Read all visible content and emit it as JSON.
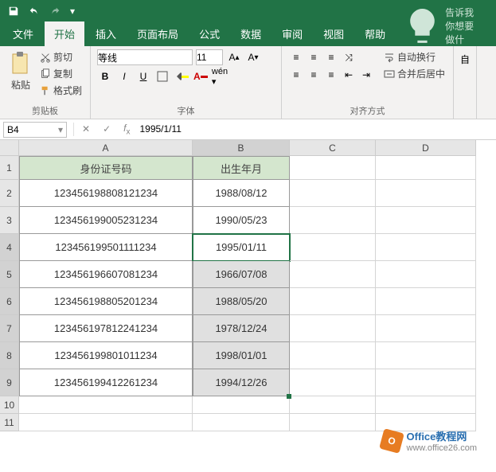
{
  "qat": {
    "save": "save",
    "undo": "undo",
    "redo": "redo"
  },
  "tabs": {
    "file": "文件",
    "home": "开始",
    "insert": "插入",
    "layout": "页面布局",
    "formulas": "公式",
    "data": "数据",
    "review": "审阅",
    "view": "视图",
    "help": "帮助",
    "tell_me": "告诉我你想要做什"
  },
  "ribbon": {
    "clipboard": {
      "paste": "粘贴",
      "cut": "剪切",
      "copy": "复制",
      "format_painter": "格式刷",
      "label": "剪贴板"
    },
    "font": {
      "name": "等线",
      "size": "11",
      "label": "字体",
      "bold": "B",
      "italic": "I",
      "underline": "U"
    },
    "alignment": {
      "wrap": "自动换行",
      "merge": "合并后居中",
      "label": "对齐方式"
    },
    "auto": "自"
  },
  "namebox": "B4",
  "formula": "1995/1/11",
  "columns": [
    "A",
    "B",
    "C",
    "D"
  ],
  "col_widths": {
    "A": 218,
    "B": 122,
    "C": 108,
    "D": 126
  },
  "rows": [
    "1",
    "2",
    "3",
    "4",
    "5",
    "6",
    "7",
    "8",
    "9",
    "10",
    "11"
  ],
  "headers": {
    "id": "身份证号码",
    "dob": "出生年月"
  },
  "data": [
    {
      "id": "123456198808121234",
      "dob": "1988/08/12"
    },
    {
      "id": "123456199005231234",
      "dob": "1990/05/23"
    },
    {
      "id": "123456199501111234",
      "dob": "1995/01/11"
    },
    {
      "id": "123456196607081234",
      "dob": "1966/07/08"
    },
    {
      "id": "123456198805201234",
      "dob": "1988/05/20"
    },
    {
      "id": "123456197812241234",
      "dob": "1978/12/24"
    },
    {
      "id": "123456199801011234",
      "dob": "1998/01/01"
    },
    {
      "id": "123456199412261234",
      "dob": "1994/12/26"
    }
  ],
  "selection": {
    "active": "B4",
    "range": "B4:B9"
  },
  "watermark": {
    "brand": "Office教程网",
    "url": "www.office26.com"
  },
  "chart_data": {
    "type": "table",
    "title": "身份证与出生年月",
    "columns": [
      "身份证号码",
      "出生年月"
    ],
    "rows": [
      [
        "123456198808121234",
        "1988/08/12"
      ],
      [
        "123456199005231234",
        "1990/05/23"
      ],
      [
        "123456199501111234",
        "1995/01/11"
      ],
      [
        "123456196607081234",
        "1966/07/08"
      ],
      [
        "123456198805201234",
        "1988/05/20"
      ],
      [
        "123456197812241234",
        "1978/12/24"
      ],
      [
        "123456199801011234",
        "1998/01/01"
      ],
      [
        "123456199412261234",
        "1994/12/26"
      ]
    ]
  }
}
